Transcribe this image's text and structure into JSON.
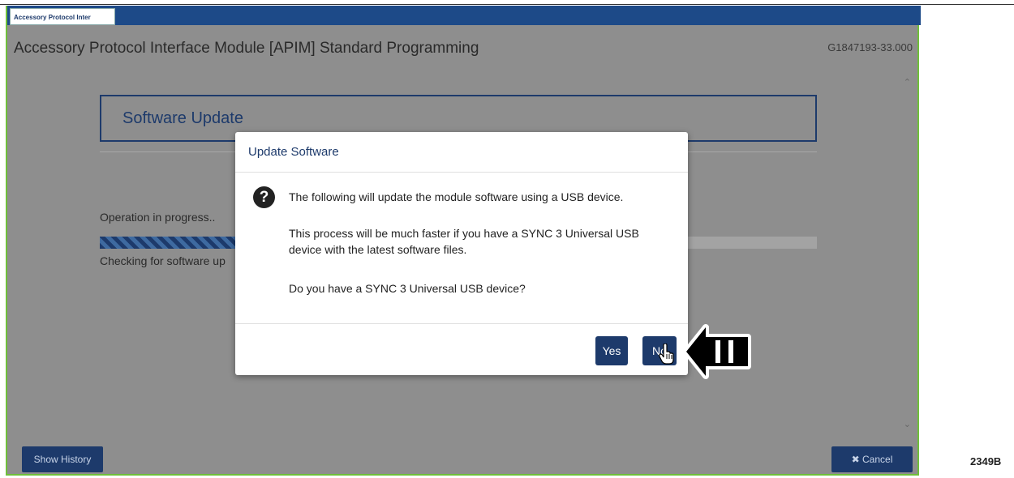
{
  "tab": {
    "label": "Accessory Protocol Inter"
  },
  "header": {
    "title": "Accessory Protocol Interface Module [APIM] Standard Programming",
    "code": "G1847193-33.000"
  },
  "panel": {
    "title": "Software Update"
  },
  "progress": {
    "operation_label": "Operation in progress..",
    "fraction": 0.2,
    "status_text": "Checking for software up"
  },
  "dialog": {
    "title": "Update Software",
    "icon": "question-circle-icon",
    "line1": "The following will update the module software using a USB device.",
    "line2": "This process will be much faster if you have a SYNC 3 Universal USB device with the latest software files.",
    "line3": "Do you have a SYNC 3 Universal USB device?",
    "yes_label": "Yes",
    "no_label": "No"
  },
  "footer": {
    "history_label": "Show History",
    "cancel_label": "✖ Cancel"
  },
  "figure_id": "2349B",
  "colors": {
    "brand_navy": "#1d3a6b",
    "tab_bar": "#1d4a88",
    "border_green": "#6fbf3a",
    "background_gray": "#8e8e8e"
  }
}
